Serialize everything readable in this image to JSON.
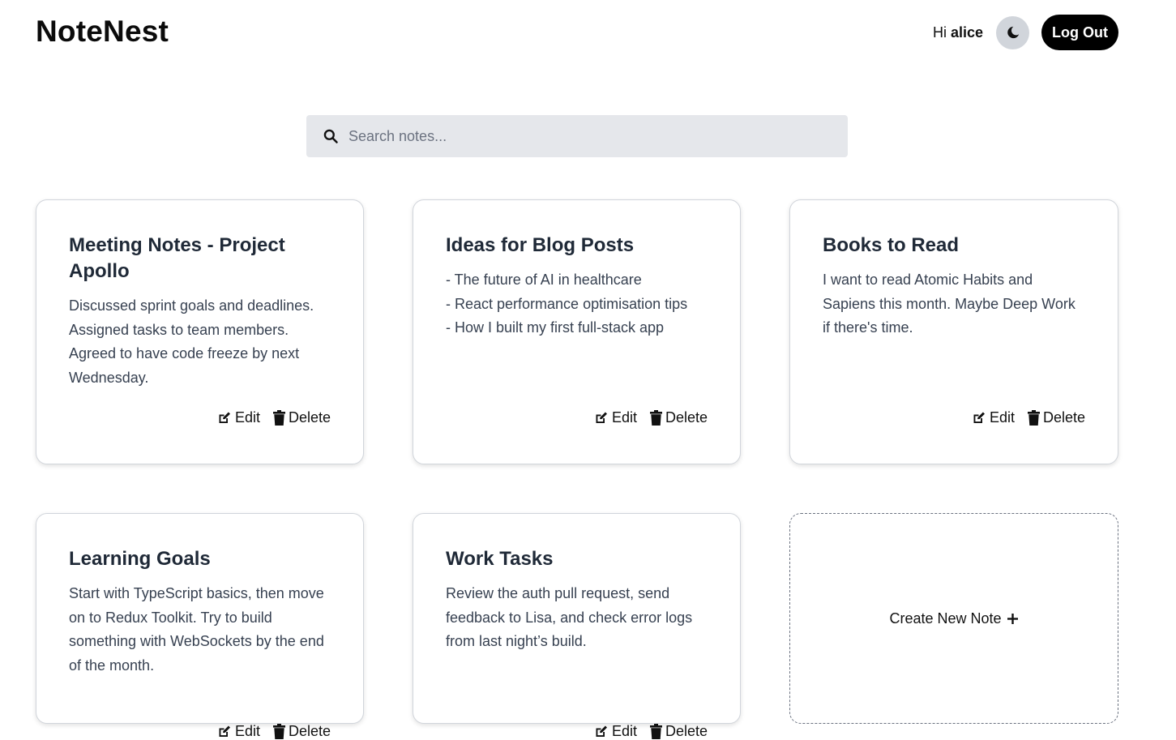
{
  "app": {
    "title": "NoteNest"
  },
  "header": {
    "greeting_prefix": "Hi",
    "username": "alice",
    "theme_icon": "moon-icon",
    "logout_label": "Log Out"
  },
  "search": {
    "placeholder": "Search notes..."
  },
  "notes": [
    {
      "title": "Meeting Notes - Project Apollo",
      "body": [
        "Discussed sprint goals and deadlines. Assigned tasks to team members. Agreed to have code freeze by next Wednesday."
      ],
      "edit_label": "Edit",
      "delete_label": "Delete"
    },
    {
      "title": "Ideas for Blog Posts",
      "body": [
        "- The future of AI in healthcare",
        "- React performance optimisation tips",
        "- How I built my first full-stack app"
      ],
      "edit_label": "Edit",
      "delete_label": "Delete"
    },
    {
      "title": "Books to Read",
      "body": [
        "I want to read Atomic Habits and Sapiens this month. Maybe Deep Work if there's time."
      ],
      "edit_label": "Edit",
      "delete_label": "Delete"
    },
    {
      "title": "Learning Goals",
      "body": [
        "Start with TypeScript basics, then move on to Redux Toolkit. Try to build something with WebSockets by the end of the month."
      ],
      "edit_label": "Edit",
      "delete_label": "Delete"
    },
    {
      "title": "Work Tasks",
      "body": [
        "Review the auth pull request, send feedback to Lisa, and check error logs from last night’s build."
      ],
      "edit_label": "Edit",
      "delete_label": "Delete"
    }
  ],
  "create_note": {
    "label": "Create New Note",
    "icon": "plus-icon"
  },
  "colors": {
    "logout_bg": "#000000",
    "toggle_bg": "#d1d5db",
    "search_bg": "#e5e7eb"
  }
}
